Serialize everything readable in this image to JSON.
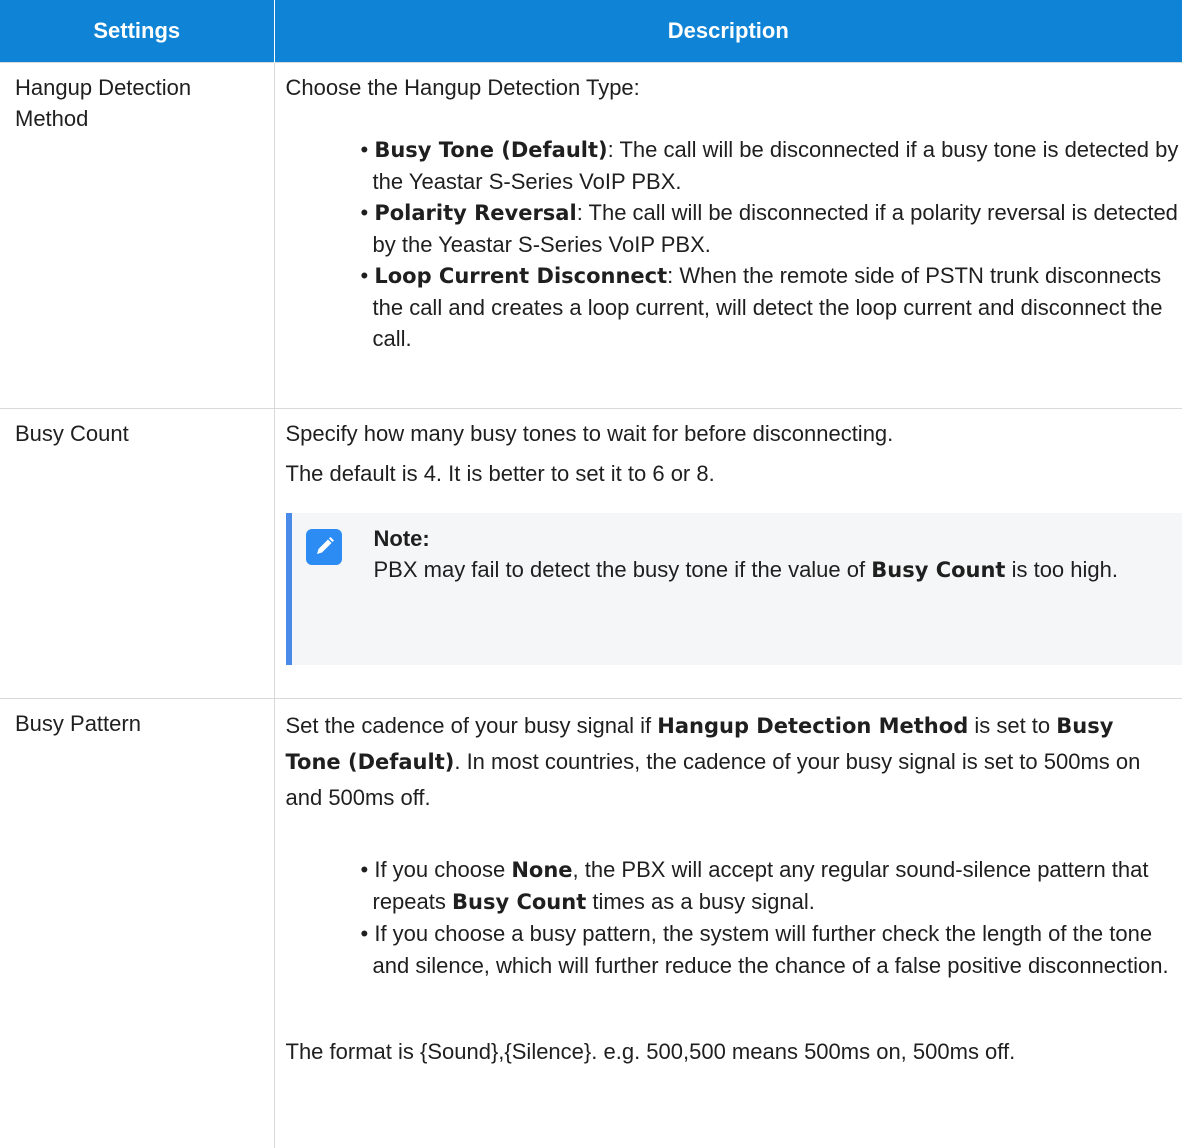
{
  "header": {
    "col1": "Settings",
    "col2": "Description"
  },
  "row1": {
    "setting": "Hangup Detection Method",
    "intro": "Choose the Hangup Detection Type:",
    "items": [
      {
        "term": "Busy Tone (Default)",
        "text": ": The call will be disconnected if a busy tone is detected by the Yeastar S-Series VoIP PBX."
      },
      {
        "term": "Polarity Reversal",
        "text": ": The call will be disconnected if a polarity reversal is detected by the Yeastar S-Series VoIP PBX."
      },
      {
        "term": "Loop Current Disconnect",
        "text": ": When the remote side of PSTN trunk disconnects the call and creates a loop current,  will detect the loop current and disconnect the call."
      }
    ]
  },
  "row2": {
    "setting": "Busy Count",
    "line1": "Specify how many busy tones to wait for before disconnecting.",
    "line2": "The default is 4. It is better to set it to 6 or 8.",
    "note": {
      "icon": "edit-note-icon",
      "title": "Note:",
      "text_before": "PBX may fail to detect the busy tone if the value of ",
      "term": "Busy Count",
      "text_after": " is too high."
    }
  },
  "row3": {
    "setting": "Busy Pattern",
    "p_before": "Set the cadence of your busy signal if ",
    "p_term1": "Hangup Detection Method",
    "p_mid": " is set to ",
    "p_term2": "Busy Tone (Default)",
    "p_after": ". In most countries, the cadence of your busy signal is set to 500ms on and 500ms off.",
    "items": [
      {
        "before": "If you choose ",
        "term": "None",
        "mid": ", the PBX will accept any regular sound-silence pattern that repeats ",
        "term2": "Busy Count",
        "after": " times as a busy signal."
      },
      {
        "text": "If you choose a busy pattern, the system will further check the length of the tone and silence, which will further reduce the chance of a false positive disconnection."
      }
    ],
    "format": "The format is {Sound},{Silence}. e.g. 500,500 means 500ms on, 500ms off."
  }
}
